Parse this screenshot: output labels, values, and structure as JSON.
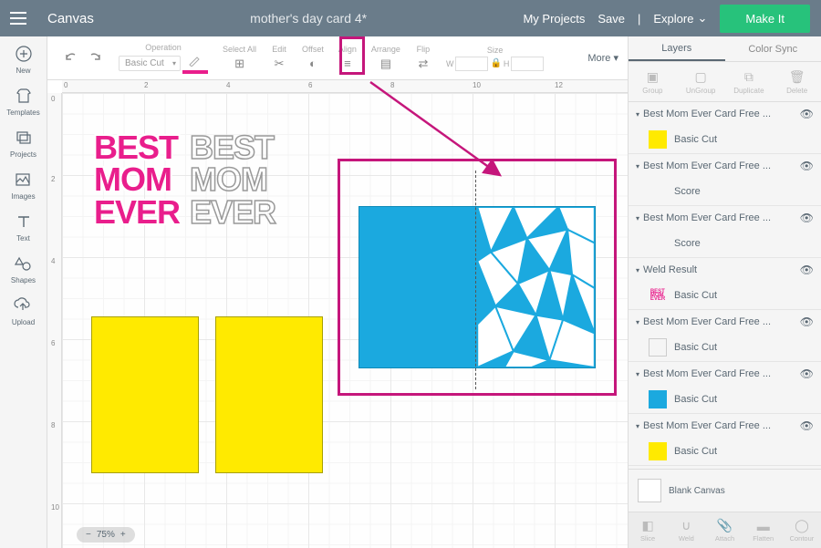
{
  "header": {
    "canvas_label": "Canvas",
    "project_name": "mother's day card 4*",
    "my_projects": "My Projects",
    "save": "Save",
    "explore": "Explore",
    "make_it": "Make It"
  },
  "left_sidebar": {
    "new": "New",
    "templates": "Templates",
    "projects": "Projects",
    "images": "Images",
    "text": "Text",
    "shapes": "Shapes",
    "upload": "Upload"
  },
  "toolbar": {
    "operation": "Operation",
    "operation_value": "Basic Cut",
    "select_all": "Select All",
    "edit": "Edit",
    "offset": "Offset",
    "align": "Align",
    "arrange": "Arrange",
    "flip": "Flip",
    "size": "Size",
    "size_w": "W",
    "size_h": "H",
    "more": "More"
  },
  "ruler_h": {
    "0": "0",
    "2": "2",
    "4": "4",
    "6": "6",
    "8": "8",
    "10": "10",
    "12": "12"
  },
  "ruler_v": {
    "0": "0",
    "2": "2",
    "4": "4",
    "6": "6",
    "8": "8",
    "10": "10"
  },
  "canvas_text": {
    "best_mom_ever": "BEST\nMOM\nEVER"
  },
  "zoom": {
    "minus": "−",
    "plus": "+",
    "value": "75%"
  },
  "right_panel": {
    "tab_layers": "Layers",
    "tab_colorsync": "Color Sync",
    "actions": {
      "group": "Group",
      "ungroup": "UnGroup",
      "duplicate": "Duplicate",
      "delete": "Delete"
    },
    "layers": [
      {
        "name": "Best Mom Ever Card Free ...",
        "op": "Basic Cut",
        "color": "#ffea00"
      },
      {
        "name": "Best Mom Ever Card Free ...",
        "op": "Score",
        "color": ""
      },
      {
        "name": "Best Mom Ever Card Free ...",
        "op": "Score",
        "color": ""
      },
      {
        "name": "Weld Result",
        "op": "Basic Cut",
        "color": "#e91e8c"
      },
      {
        "name": "Best Mom Ever Card Free ...",
        "op": "Basic Cut",
        "color": ""
      },
      {
        "name": "Best Mom Ever Card Free ...",
        "op": "Basic Cut",
        "color": "#1ba9df"
      },
      {
        "name": "Best Mom Ever Card Free ...",
        "op": "Basic Cut",
        "color": "#ffea00"
      }
    ],
    "blank_canvas": "Blank Canvas",
    "bottom": {
      "slice": "Slice",
      "weld": "Weld",
      "attach": "Attach",
      "flatten": "Flatten",
      "contour": "Contour"
    }
  }
}
